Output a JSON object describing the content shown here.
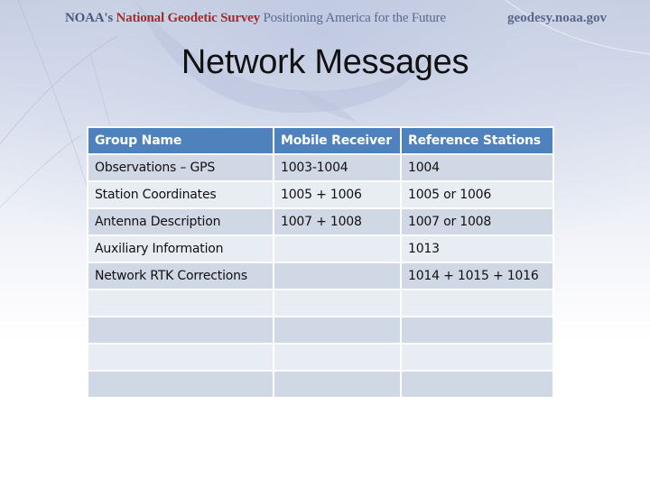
{
  "header": {
    "org_prefix": "NOAA's",
    "org_name": "National Geodetic Survey",
    "tagline": "Positioning America for the Future",
    "website": "geodesy.noaa.gov"
  },
  "slide": {
    "title": "Network Messages"
  },
  "table": {
    "columns": [
      "Group Name",
      "Mobile Receiver",
      "Reference Stations"
    ],
    "rows": [
      [
        "Observations – GPS",
        "1003-1004",
        "1004"
      ],
      [
        "Station Coordinates",
        "1005 + 1006",
        "1005 or 1006"
      ],
      [
        "Antenna Description",
        "1007 + 1008",
        "1007 or 1008"
      ],
      [
        "Auxiliary Information",
        "",
        "1013"
      ],
      [
        "Network RTK Corrections",
        "",
        "1014 + 1015 + 1016"
      ],
      [
        "",
        "",
        ""
      ],
      [
        "",
        "",
        ""
      ],
      [
        "",
        "",
        ""
      ],
      [
        "",
        "",
        ""
      ]
    ]
  },
  "colors": {
    "header_fill": "#4f81bd",
    "row_band_dark": "#d0d8e6",
    "row_band_light": "#e8ecf3",
    "ngs_red": "#9b3030",
    "noaa_blue": "#4a587e"
  }
}
